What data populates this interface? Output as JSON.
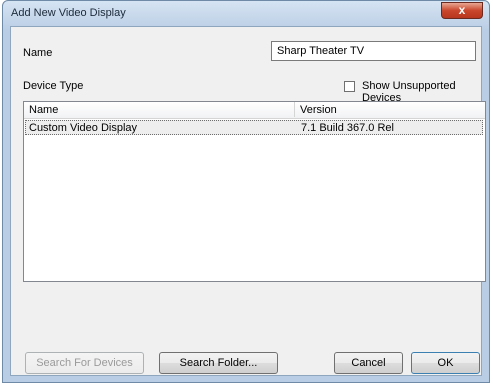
{
  "window": {
    "title": "Add New Video Display",
    "close_label": "x"
  },
  "form": {
    "name_label": "Name",
    "name_value": "Sharp Theater TV",
    "device_type_label": "Device Type",
    "show_unsupported_label": "Show Unsupported Devices",
    "show_unsupported_checked": false
  },
  "list": {
    "columns": [
      "Name",
      "Version"
    ],
    "rows": [
      {
        "name": "Custom Video Display",
        "version": "7.1 Build 367.0 Rel",
        "selected": true
      }
    ]
  },
  "buttons": {
    "search_devices": "Search For Devices",
    "search_folder": "Search Folder...",
    "cancel": "Cancel",
    "ok": "OK"
  }
}
